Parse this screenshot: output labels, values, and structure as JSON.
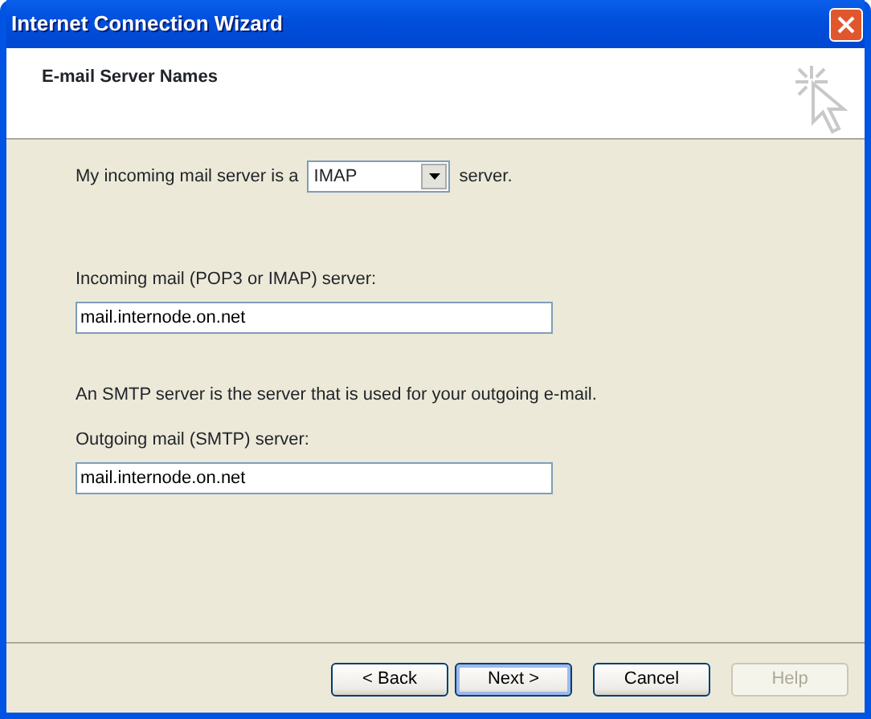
{
  "window": {
    "title": "Internet Connection Wizard"
  },
  "header": {
    "title": "E-mail Server Names"
  },
  "server_type": {
    "label_before": "My incoming mail server is a",
    "value": "IMAP",
    "label_after": "server."
  },
  "fields": [
    {
      "label": "Incoming mail (POP3 or IMAP) server:",
      "value": "mail.internode.on.net"
    },
    {
      "note": "An SMTP server is the server that is used for your outgoing e-mail.",
      "label": "Outgoing mail (SMTP) server:",
      "value": "mail.internode.on.net"
    }
  ],
  "buttons": [
    {
      "label": "< Back",
      "disabled": false,
      "focused": false
    },
    {
      "label": "Next >",
      "disabled": false,
      "focused": true
    },
    {
      "label": "Cancel",
      "disabled": false,
      "focused": false
    },
    {
      "label": "Help",
      "disabled": true,
      "focused": false
    }
  ]
}
